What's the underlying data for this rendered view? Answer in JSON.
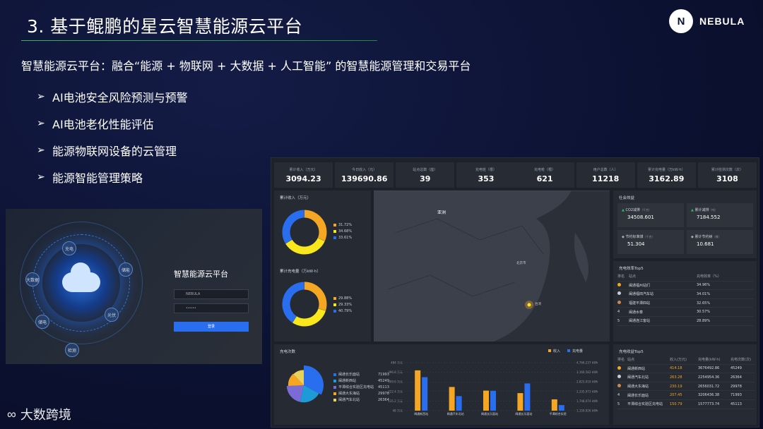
{
  "slide": {
    "title": "3. 基于鲲鹏的星云智慧能源云平台",
    "subtitle": "智慧能源云平台：融合“能源 + 物联网 + 大数据 + 人工智能” 的智慧能源管理和交易平台",
    "bullets": [
      "AI电池安全风险预测与预警",
      "AI电池老化性能评估",
      "能源物联网设备的云管理",
      "能源智能管理策略"
    ],
    "logo_mark": "N",
    "logo_text": "NEBULA",
    "watermark": "大数跨境",
    "colors": {
      "bg": "#0b1130",
      "accent_green": "#2db85c",
      "orange": "#f5a623",
      "yellow": "#f8e71c",
      "blue": "#2a6ef0"
    }
  },
  "login": {
    "title": "智慧能源云平台",
    "username_value": "NEBULA",
    "password_value": "•••••",
    "button_label": "登录",
    "nodes": [
      "充电",
      "储能",
      "光伏",
      "检测",
      "大数据",
      "储电"
    ]
  },
  "dashboard": {
    "kpis": [
      {
        "label": "累计收入（万元）",
        "value": "3094.23"
      },
      {
        "label": "今日收入（元）",
        "value": "139690.86"
      },
      {
        "label": "站点总数（座）",
        "value": "39"
      },
      {
        "label": "充电桩（根）",
        "value": "353"
      },
      {
        "label": "充电枪（根）",
        "value": "621"
      },
      {
        "label": "用户总数（人）",
        "value": "11218"
      },
      {
        "label": "累计充电量（万kW·h）",
        "value": "3162.89"
      },
      {
        "label": "累计检测次数（次）",
        "value": "3108"
      }
    ],
    "income_title": "累计收入（万元）",
    "income_legend": [
      {
        "pct": "31.72%",
        "color": "#f5a623"
      },
      {
        "pct": "34.68%",
        "color": "#f8e71c"
      },
      {
        "pct": "33.61%",
        "color": "#2a6ef0"
      }
    ],
    "energy_title": "累计充电量（万kW·h）",
    "energy_legend": [
      {
        "pct": "29.88%",
        "color": "#f5a623"
      },
      {
        "pct": "29.33%",
        "color": "#f8e71c"
      },
      {
        "pct": "40.79%",
        "color": "#2a6ef0"
      }
    ],
    "map": {
      "region_label": "亚洲",
      "place_label": "北京市",
      "marker_label": "台湾"
    },
    "energy_saving": {
      "title": "社会效益",
      "items": [
        {
          "label": "CO2减排",
          "unit": "（千克）",
          "value": "34508.601"
        },
        {
          "label": "累计减排",
          "unit": "（吨）",
          "value": "7184.552"
        },
        {
          "label": "节约标准煤",
          "unit": "（千克）",
          "value": "51.304"
        },
        {
          "label": "累计节约树",
          "unit": "（棵）",
          "value": "10.681"
        }
      ]
    },
    "rate_top5": {
      "title": "充电效率Top5",
      "headers": [
        "排名",
        "站点",
        "充电效率（%）"
      ],
      "rows": [
        {
          "rank": "1",
          "site": "闽通福州站们",
          "value": "34.96%"
        },
        {
          "rank": "2",
          "site": "闽通福田汽车站",
          "value": "34.01%"
        },
        {
          "rank": "3",
          "site": "福建平潭四站",
          "value": "32.65%"
        },
        {
          "rank": "4",
          "site": "闽通水泰",
          "value": "30.57%"
        },
        {
          "rank": "5",
          "site": "闽通连江客站",
          "value": "28.89%"
        }
      ]
    },
    "charge_count": {
      "title": "充电次数",
      "legend": [
        {
          "name": "闽通长乐面站",
          "value": "71993",
          "color": "#2a6ef0"
        },
        {
          "name": "闽通新西站",
          "value": "45249",
          "color": "#1e9bd7"
        },
        {
          "name": "平潭综合实验区充电站",
          "value": "45113",
          "color": "#7b6bd6"
        },
        {
          "name": "闽通大东海站",
          "value": "29978",
          "color": "#f5a623"
        },
        {
          "name": "闽通汽车北站",
          "value": "26364",
          "color": "#e8d25a"
        }
      ]
    },
    "bar_chart": {
      "legend": [
        "收入",
        "充电量"
      ],
      "left_ticks": [
        "484 万元",
        "396.8 万元",
        "309.6 万元",
        "222.4 万元",
        "135.2 万元",
        "48 万元"
      ],
      "right_ticks": [
        "4,766,237 kWh",
        "3,160,583 kWh",
        "2,823,019 kWh",
        "2,335,973 kWh",
        "1,748,074 kWh",
        "1,159,926 kWh"
      ],
      "categories": [
        "闽通新西站",
        "闽通汽车北站",
        "闽通长乐面站",
        "闽通长乐面站",
        "平潭综合实验区充电站"
      ],
      "income": [
        414.18,
        263.28,
        230.19,
        207.45,
        150.79
      ],
      "energy": [
        3676492.86,
        2254954.36,
        2656031.72,
        3206436.38,
        1577773.74
      ]
    },
    "income_top5": {
      "title": "充电收益Top5",
      "headers": [
        "排名",
        "站点",
        "收入(万元)",
        "充电量(kW·h)",
        "充电次数(次)"
      ],
      "rows": [
        {
          "rank": "1",
          "site": "闽通新西站",
          "income": "414.18",
          "energy": "3676492.86",
          "count": "45249"
        },
        {
          "rank": "2",
          "site": "闽通汽车北站",
          "income": "263.28",
          "energy": "2254954.36",
          "count": "26364"
        },
        {
          "rank": "3",
          "site": "闽通大东海站",
          "income": "230.19",
          "energy": "2656031.72",
          "count": "29978"
        },
        {
          "rank": "4",
          "site": "闽通长乐面站",
          "income": "207.45",
          "energy": "3206436.38",
          "count": "71993"
        },
        {
          "rank": "5",
          "site": "平潭综合实验区充电站",
          "income": "150.79",
          "energy": "1577773.74",
          "count": "45113"
        }
      ]
    }
  }
}
